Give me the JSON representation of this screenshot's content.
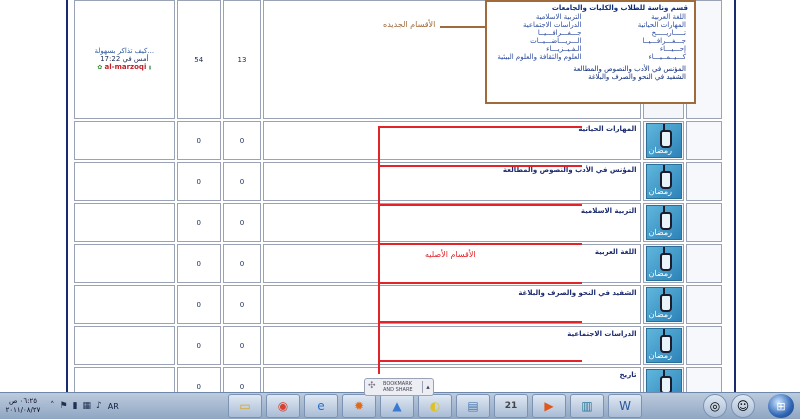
{
  "forum": {
    "top_row": {
      "subforum_box": {
        "header": "قسم وناسة للطلاب والكليات والجامعات",
        "right_col": [
          "اللغة العربية",
          "المهارات الحياتية",
          "تـــــاريـــــخ",
          "جـــغـــرافـــيــا",
          "إحـــيـــاء",
          "كـــيــمــيـــاء"
        ],
        "left_col": [
          "التربية الاسلامية",
          "الدراسات الاجتماعية",
          "جـــغـــرافـــيــا",
          "الـــريـــاضـــيــات",
          "الـفـيــزيـــاء",
          "العلوم والثقافة والعلوم البيئية"
        ],
        "footer_lines": [
          "المؤنس في الأدب والنصوص والمطالعة",
          "الشفيد في النحو والصرف والبلاغة"
        ]
      },
      "topics": "13",
      "posts": "54",
      "last_post": {
        "title": "كيف تذاكر بسهولة...",
        "time": "أمس في 17:22",
        "user": "al-marzoqi"
      },
      "annotation_new": "الأقسام الجديده"
    },
    "rows": [
      {
        "title": "المهارات الحياتية",
        "topics": "0",
        "posts": "0"
      },
      {
        "title": "المؤنس في الأدب والنصوص والمطالعة",
        "topics": "0",
        "posts": "0"
      },
      {
        "title": "التربية الاسلامية",
        "topics": "0",
        "posts": "0"
      },
      {
        "title": "اللغة العربية",
        "topics": "0",
        "posts": "0"
      },
      {
        "title": "الشفيد في النحو والصرف والبلاغة",
        "topics": "0",
        "posts": "0"
      },
      {
        "title": "الدراسات الاجتماعية",
        "topics": "0",
        "posts": "0"
      },
      {
        "title": "تاريخ",
        "topics": "0",
        "posts": "0"
      }
    ],
    "annotation_original": "الأقسام الأصليه",
    "icon_text": "رمضان"
  },
  "bookmark_widget": {
    "label": "BOOKMARK AND SHARE"
  },
  "taskbar": {
    "time": "٠٦:٢٥ ص",
    "date": "٢٠١١/٠٨/٢٧",
    "language": "AR",
    "apps": [
      "folder",
      "chrome",
      "ie",
      "firefox",
      "winamp",
      "media",
      "files",
      "calendar",
      "media-player",
      "network",
      "word",
      "globe"
    ],
    "calendar_day": "21"
  },
  "colors": {
    "frame": "#1a2a6e",
    "annotation_red": "#e0242a",
    "annotation_brown": "#a06a3a",
    "username": "#c0202a"
  }
}
